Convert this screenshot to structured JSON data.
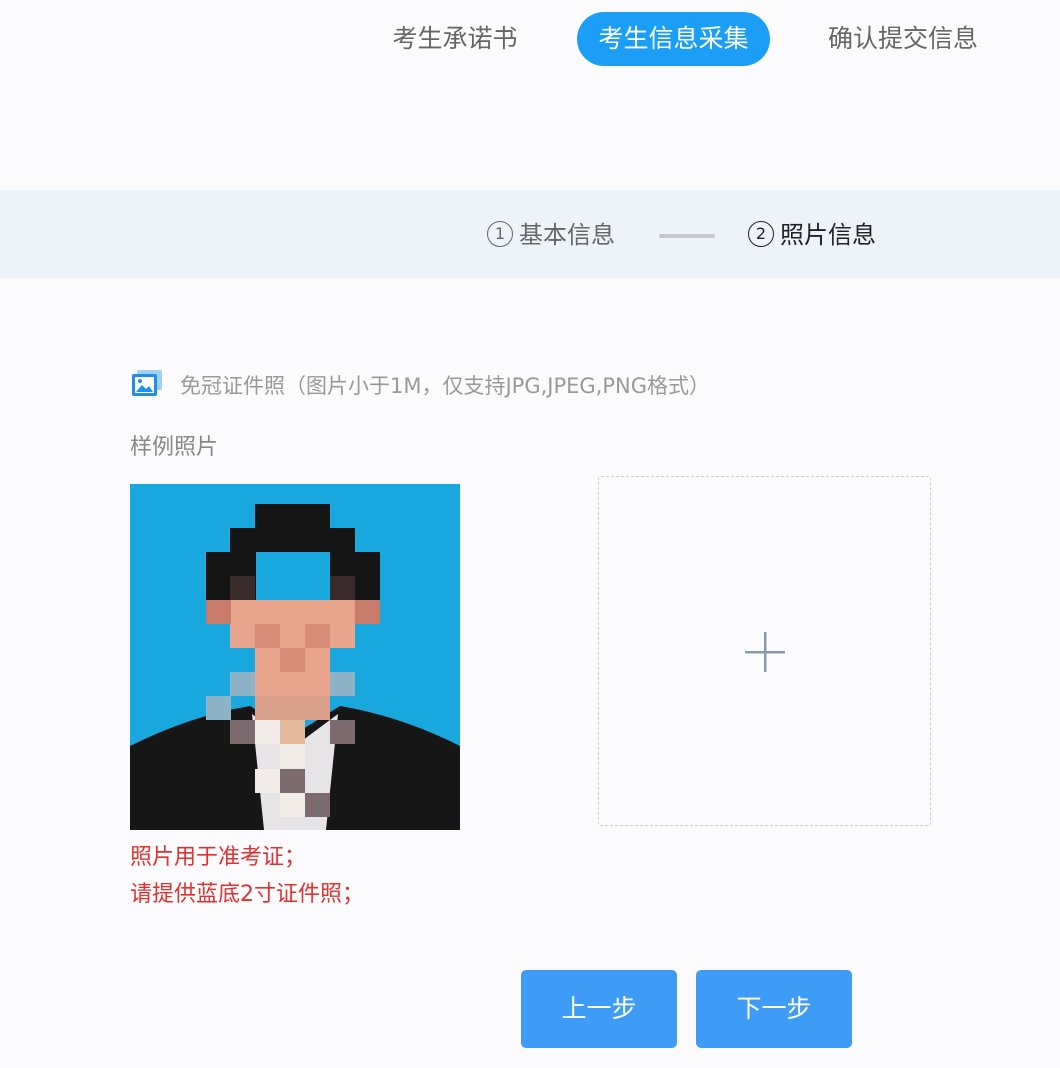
{
  "tabs": [
    {
      "label": "考生承诺书",
      "active": false
    },
    {
      "label": "考生信息采集",
      "active": true
    },
    {
      "label": "确认提交信息",
      "active": false
    }
  ],
  "steps": [
    {
      "num": "1",
      "label": "基本信息",
      "active": false
    },
    {
      "num": "2",
      "label": "照片信息",
      "active": true
    }
  ],
  "photo_section": {
    "hint": "免冠证件照（图片小于1M，仅支持JPG,JPEG,PNG格式）",
    "sample_label": "样例照片",
    "notes": [
      "照片用于准考证；",
      "请提供蓝底2寸证件照；"
    ]
  },
  "buttons": {
    "prev_label": "上一步",
    "next_label": "下一步"
  },
  "colors": {
    "accent": "#1b9ef5",
    "button": "#3e9cf6",
    "note_red": "#e03131",
    "photo_background": "#19a8de"
  },
  "icons": {
    "photo_hint": "image-icon",
    "upload": "plus-icon"
  }
}
